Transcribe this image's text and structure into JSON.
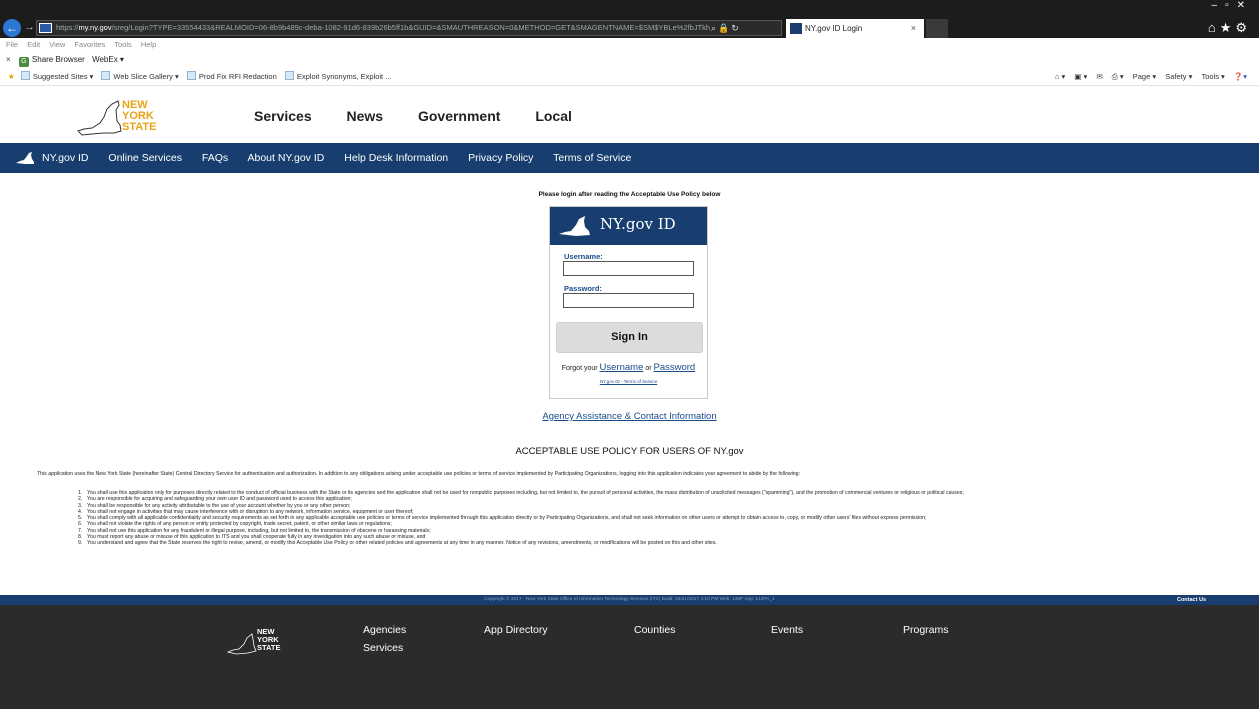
{
  "browser": {
    "url_prefix": "https://",
    "url_host": "my.ny.gov",
    "url_rest": "/sreg/Login?TYPE=33554433&REALMOID=06-8b9b489c-deba-1082-91d6-839b26b5ff1b&GUID=&SMAUTHREASON=0&METHOD=GET&SMAGENTNAME=$SM$YBLe%2fbJTkh",
    "tab_title": "NY.gov ID Login",
    "tab_close": "×",
    "menu": [
      "File",
      "Edit",
      "View",
      "Favorites",
      "Tools",
      "Help"
    ],
    "toolbar_close": "×",
    "share_browser": "Share Browser",
    "webex": "WebEx ▾",
    "favorites": [
      "Suggested Sites ▾",
      "Web Slice Gallery ▾",
      "Prod Fix RFI Redaction",
      "Exploit Synonyms, Exploit ..."
    ],
    "commands": [
      "Page ▾",
      "Safety ▾",
      "Tools ▾"
    ]
  },
  "header": {
    "logo_text": [
      "NEW",
      "YORK",
      "STATE"
    ],
    "topnav": [
      "Services",
      "News",
      "Government",
      "Local"
    ]
  },
  "navbar": {
    "items": [
      "NY.gov ID",
      "Online Services",
      "FAQs",
      "About NY.gov ID",
      "Help Desk Information",
      "Privacy Policy",
      "Terms of Service"
    ]
  },
  "login": {
    "intro": "Please login after reading the Acceptable Use Policy below",
    "box_title": "NY.gov ID",
    "username_label": "Username:",
    "username_value": "",
    "password_label": "Password:",
    "password_value": "",
    "signin_label": "Sign In",
    "forgot_prefix": "Forgot your",
    "forgot_username": "Username",
    "forgot_or": "or",
    "forgot_password": "Password",
    "tos_link": "NY.gov ID - Terms of Service"
  },
  "agency_link": "Agency Assistance & Contact Information",
  "aup": {
    "title": "ACCEPTABLE USE POLICY FOR USERS OF NY.gov",
    "intro": "This application uses the New York State (hereinafter State) Central Directory Service for authentication and authorization. In addition to any obligations arising under acceptable use policies or terms of service implemented by Participating Organizations, logging into this application indicates your agreement to abide by the following:",
    "items": [
      "You shall use this application only for purposes directly related to the conduct of official business with the State or its agencies and the application shall not be used for nonpublic purposes including, but not limited to, the pursuit of personal activities, the mass distribution of unsolicited messages (\"spamming\"), and the promotion of commercial ventures or religious or political causes;",
      "You are responsible for acquiring and safeguarding your own user ID and password used to access this application;",
      "You shall be responsible for any activity attributable to the use of your account whether by you or any other person;",
      "You shall not engage in activities that may cause interference with or disruption to any network, information service, equipment or user thereof;",
      "You shall comply with all applicable confidentiality and security requirements as set forth in any applicable acceptable use policies or terms of service implemented through this application directly or by Participating Organizations, and shall not seek information on other users or attempt to obtain access to, copy, or modify other users' files without express permission;",
      "You shall not violate the rights of any person or entity protected by copyright, trade secret, patent, or other similar laws or regulations;",
      "You shall not use this application for any fraudulent or illegal purpose, including, but not limited to, the transmission of obscene or harassing materials;",
      "You must report any abuse or misuse of this application to ITS and you shall cooperate fully in any investigation into any such abuse or misuse, and",
      "You understand and agree that the State reserves the right to revise, amend, or modify this Acceptable Use Policy or other related policies and agreements at any time in any manner. Notice of any revisions, amendments, or modifications will be posted on this and other sites."
    ]
  },
  "footer": {
    "copyright": "Copyright © 2017 - New York State Office of Information Technology Services (ITS)   Build: 04/21/2017 4:10 PM Web: 136P App: 142PA_1",
    "contact": "Contact Us",
    "logo_text": [
      "NEW",
      "YORK",
      "STATE"
    ],
    "links": [
      "Agencies",
      "Services",
      "App Directory",
      "Counties",
      "Events",
      "Programs"
    ]
  }
}
